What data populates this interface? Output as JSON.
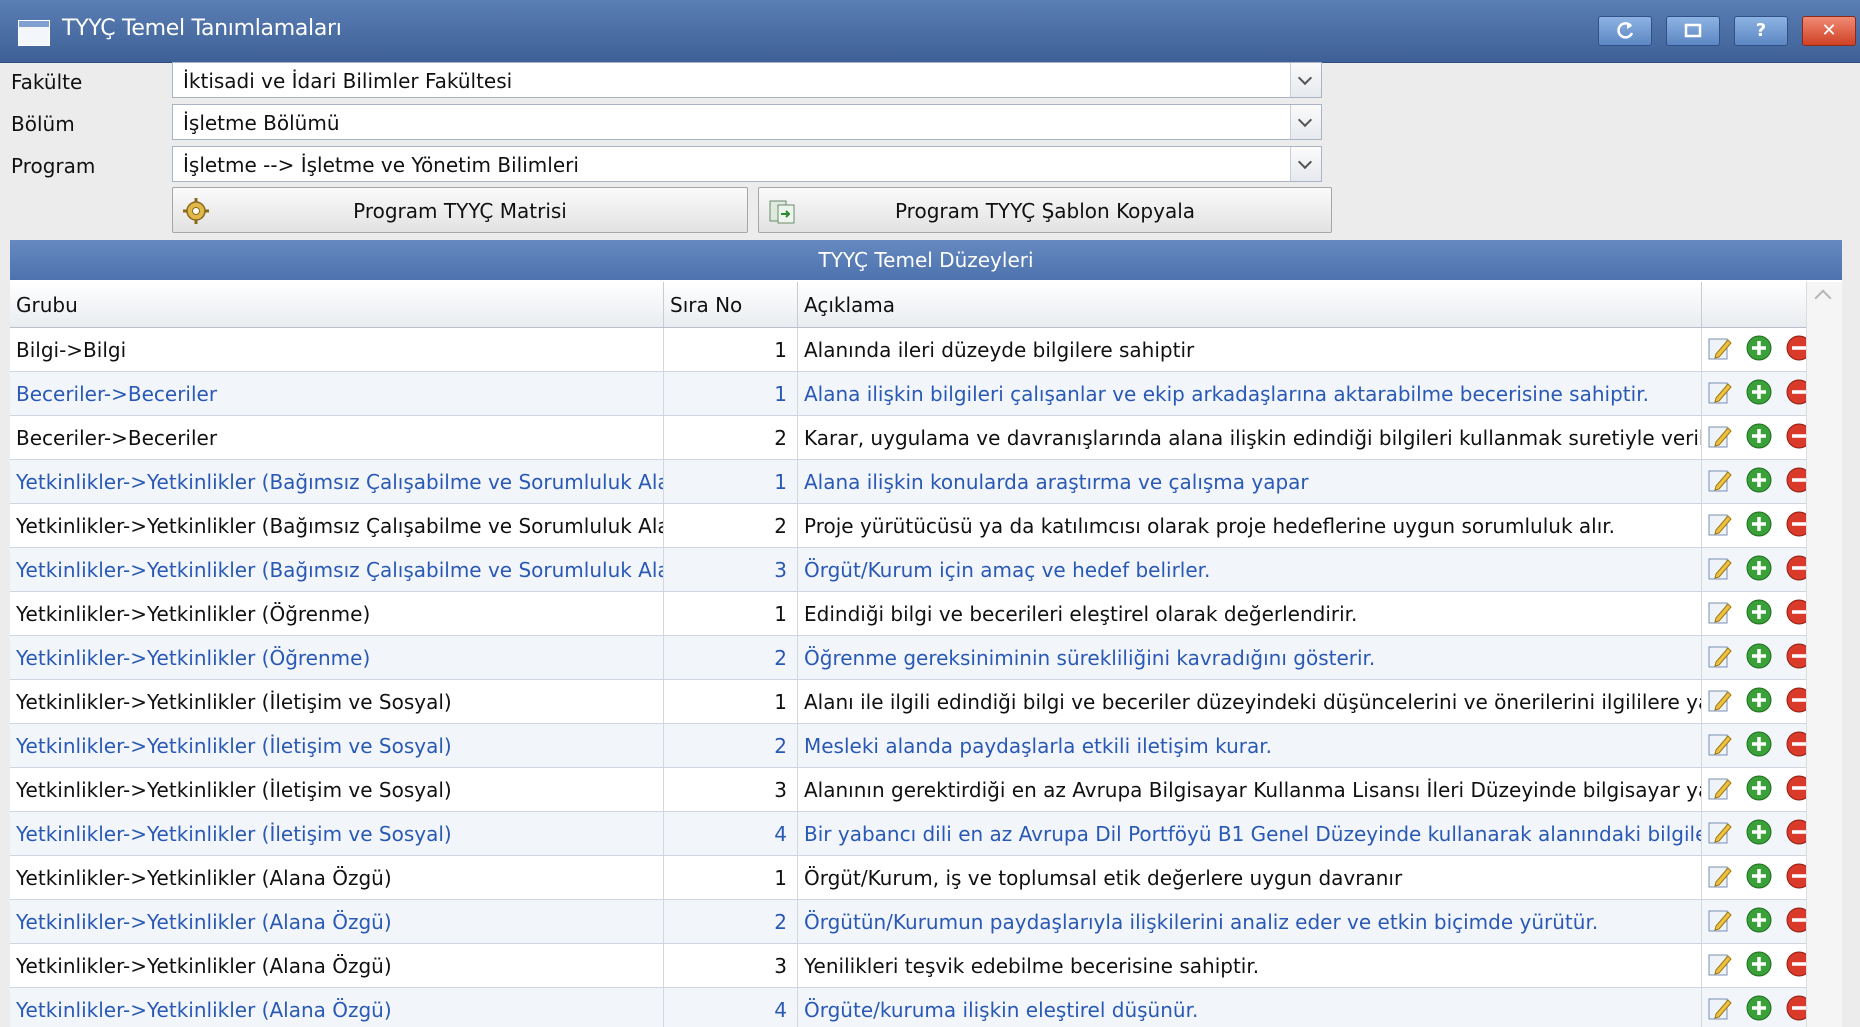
{
  "window": {
    "title": "TYYÇ Temel Tanımlamaları"
  },
  "form": {
    "faculty": {
      "label": "Fakülte",
      "value": "İktisadi ve İdari Bilimler Fakültesi"
    },
    "department": {
      "label": "Bölüm",
      "value": "İşletme Bölümü"
    },
    "program": {
      "label": "Program",
      "value": "İşletme --> İşletme ve Yönetim Bilimleri"
    }
  },
  "actions": {
    "matrix_label": "Program TYYÇ Matrisi",
    "copy_label": "Program TYYÇ Şablon Kopyala"
  },
  "grid": {
    "caption": "TYYÇ Temel Düzeyleri",
    "columns": [
      "Grubu",
      "Sıra No",
      "Açıklama"
    ],
    "rows": [
      {
        "group": "Bilgi->Bilgi",
        "no": "1",
        "desc": "Alanında ileri düzeyde bilgilere sahiptir"
      },
      {
        "group": "Beceriler->Beceriler",
        "no": "1",
        "desc": "Alana ilişkin bilgileri çalışanlar ve ekip arkadaşlarına aktarabilme becerisine sahiptir."
      },
      {
        "group": "Beceriler->Beceriler",
        "no": "2",
        "desc": "Karar, uygulama ve davranışlarında alana ilişkin edindiği bilgileri kullanmak suretiyle verileri yorumla"
      },
      {
        "group": "Yetkinlikler->Yetkinlikler (Bağımsız Çalışabilme ve Sorumluluk Alabilme)",
        "no": "1",
        "desc": "Alana ilişkin konularda araştırma ve çalışma yapar"
      },
      {
        "group": "Yetkinlikler->Yetkinlikler (Bağımsız Çalışabilme ve Sorumluluk Alabilme)",
        "no": "2",
        "desc": "Proje yürütücüsü ya da katılımcısı olarak proje hedeflerine uygun sorumluluk alır."
      },
      {
        "group": "Yetkinlikler->Yetkinlikler (Bağımsız Çalışabilme ve Sorumluluk Alabilme)",
        "no": "3",
        "desc": "Örgüt/Kurum için amaç ve hedef belirler."
      },
      {
        "group": "Yetkinlikler->Yetkinlikler (Öğrenme)",
        "no": "1",
        "desc": "Edindiği bilgi ve becerileri eleştirel olarak değerlendirir."
      },
      {
        "group": "Yetkinlikler->Yetkinlikler (Öğrenme)",
        "no": "2",
        "desc": "Öğrenme gereksiniminin sürekliliğini kavradığını gösterir."
      },
      {
        "group": "Yetkinlikler->Yetkinlikler (İletişim ve Sosyal)",
        "no": "1",
        "desc": "Alanı ile ilgili edindiği bilgi ve beceriler düzeyindeki düşüncelerini ve önerilerini ilgililere yazılı ve sözlü"
      },
      {
        "group": "Yetkinlikler->Yetkinlikler (İletişim ve Sosyal)",
        "no": "2",
        "desc": "Mesleki alanda paydaşlarla etkili iletişim kurar."
      },
      {
        "group": "Yetkinlikler->Yetkinlikler (İletişim ve Sosyal)",
        "no": "3",
        "desc": "Alanının gerektirdiği en az Avrupa Bilgisayar Kullanma Lisansı İleri Düzeyinde bilgisayar yazılımı ile b"
      },
      {
        "group": "Yetkinlikler->Yetkinlikler (İletişim ve Sosyal)",
        "no": "4",
        "desc": "Bir yabancı dili en az Avrupa Dil Portföyü B1 Genel Düzeyinde kullanarak alanındaki bilgileri izler ve"
      },
      {
        "group": "Yetkinlikler->Yetkinlikler (Alana Özgü)",
        "no": "1",
        "desc": "Örgüt/Kurum, iş ve toplumsal etik değerlere uygun davranır"
      },
      {
        "group": "Yetkinlikler->Yetkinlikler (Alana Özgü)",
        "no": "2",
        "desc": "Örgütün/Kurumun paydaşlarıyla ilişkilerini analiz eder ve etkin biçimde yürütür."
      },
      {
        "group": "Yetkinlikler->Yetkinlikler (Alana Özgü)",
        "no": "3",
        "desc": "Yenilikleri teşvik edebilme becerisine sahiptir."
      },
      {
        "group": "Yetkinlikler->Yetkinlikler (Alana Özgü)",
        "no": "4",
        "desc": "Örgüte/kuruma ilişkin eleştirel düşünür."
      }
    ]
  },
  "colors": {
    "titlebar": "#4a6ea8",
    "caption": "#5a7fb8",
    "alt_row_text": "#2a59b5",
    "add_icon": "#3aa03a",
    "delete_icon": "#d93a2a"
  },
  "icons": {
    "titlebar_buttons": [
      "refresh-icon",
      "restore-icon",
      "help-icon",
      "close-icon"
    ],
    "row_actions": [
      "edit-icon",
      "add-icon",
      "delete-icon"
    ]
  }
}
